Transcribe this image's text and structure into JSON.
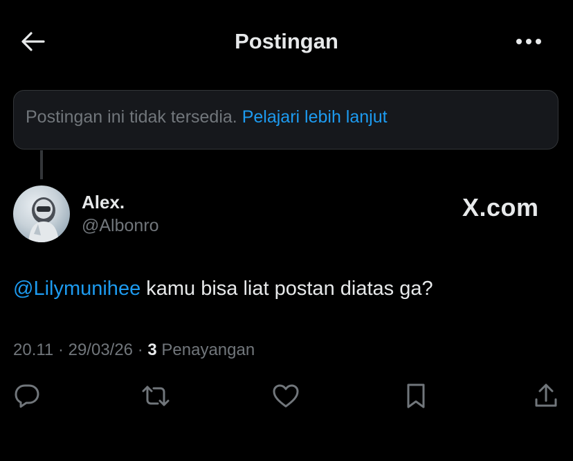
{
  "header": {
    "title": "Postingan",
    "back_icon": "arrow-left-icon",
    "more_icon": "more-horizontal-icon"
  },
  "unavailable": {
    "text": "Postingan ini tidak tersedia.",
    "link": "Pelajari lebih lanjut"
  },
  "author": {
    "display_name": "Alex.",
    "handle": "@Albonro"
  },
  "watermark": "X.com",
  "post": {
    "mention": "@Lilymunihee",
    "text": "kamu bisa liat postan diatas ga?"
  },
  "meta": {
    "time": "20.11",
    "date": "29/03/26",
    "views_count": "3",
    "views_label": "Penayangan"
  },
  "actions": [
    "reply-icon",
    "repost-icon",
    "like-icon",
    "bookmark-icon",
    "share-icon"
  ],
  "colors": {
    "background": "#000000",
    "text": "#e7e9ea",
    "secondary": "#71767b",
    "accent": "#1d9bf0"
  }
}
